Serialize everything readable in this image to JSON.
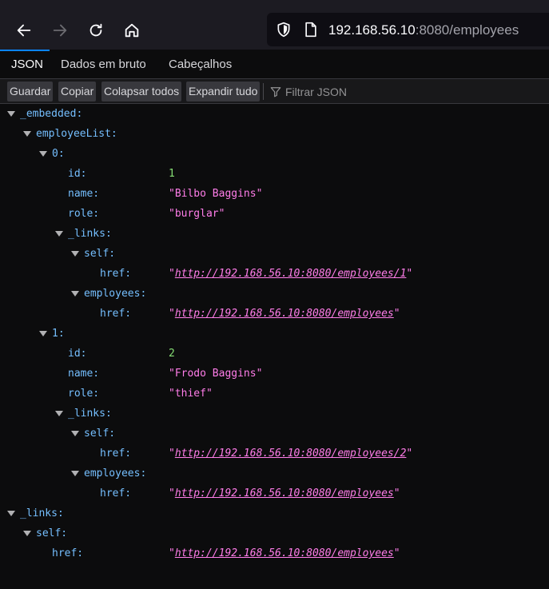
{
  "browser": {
    "url_host": "192.168.56.10",
    "url_rest": ":8080/employees"
  },
  "tabs": [
    {
      "label": "JSON",
      "selected": true
    },
    {
      "label": "Dados em bruto",
      "selected": false
    },
    {
      "label": "Cabeçalhos",
      "selected": false
    }
  ],
  "toolbar": {
    "save": "Guardar",
    "copy": "Copiar",
    "collapse_all": "Colapsar todos",
    "expand_all": "Expandir tudo",
    "filter_placeholder": "Filtrar JSON"
  },
  "tree": {
    "embedded_key": "_embedded:",
    "employee_list_key": "employeeList:",
    "employees": [
      {
        "index": "0:",
        "id_key": "id:",
        "id": "1",
        "name_key": "name:",
        "name": "\"Bilbo Baggins\"",
        "role_key": "role:",
        "role": "\"burglar\"",
        "links_key": "_links:",
        "self_key": "self:",
        "self_href_key": "href:",
        "self_href_q1": "\"",
        "self_href": "http://192.168.56.10:8080/employees/1",
        "self_href_q2": "\"",
        "employees_key": "employees:",
        "emp_href_key": "href:",
        "emp_href_q1": "\"",
        "emp_href": "http://192.168.56.10:8080/employees",
        "emp_href_q2": "\""
      },
      {
        "index": "1:",
        "id_key": "id:",
        "id": "2",
        "name_key": "name:",
        "name": "\"Frodo Baggins\"",
        "role_key": "role:",
        "role": "\"thief\"",
        "links_key": "_links:",
        "self_key": "self:",
        "self_href_key": "href:",
        "self_href_q1": "\"",
        "self_href": "http://192.168.56.10:8080/employees/2",
        "self_href_q2": "\"",
        "employees_key": "employees:",
        "emp_href_key": "href:",
        "emp_href_q1": "\"",
        "emp_href": "http://192.168.56.10:8080/employees",
        "emp_href_q2": "\""
      }
    ],
    "root_links_key": "_links:",
    "root_self_key": "self:",
    "root_href_key": "href:",
    "root_href_q1": "\"",
    "root_href": "http://192.168.56.10:8080/employees",
    "root_href_q2": "\""
  }
}
